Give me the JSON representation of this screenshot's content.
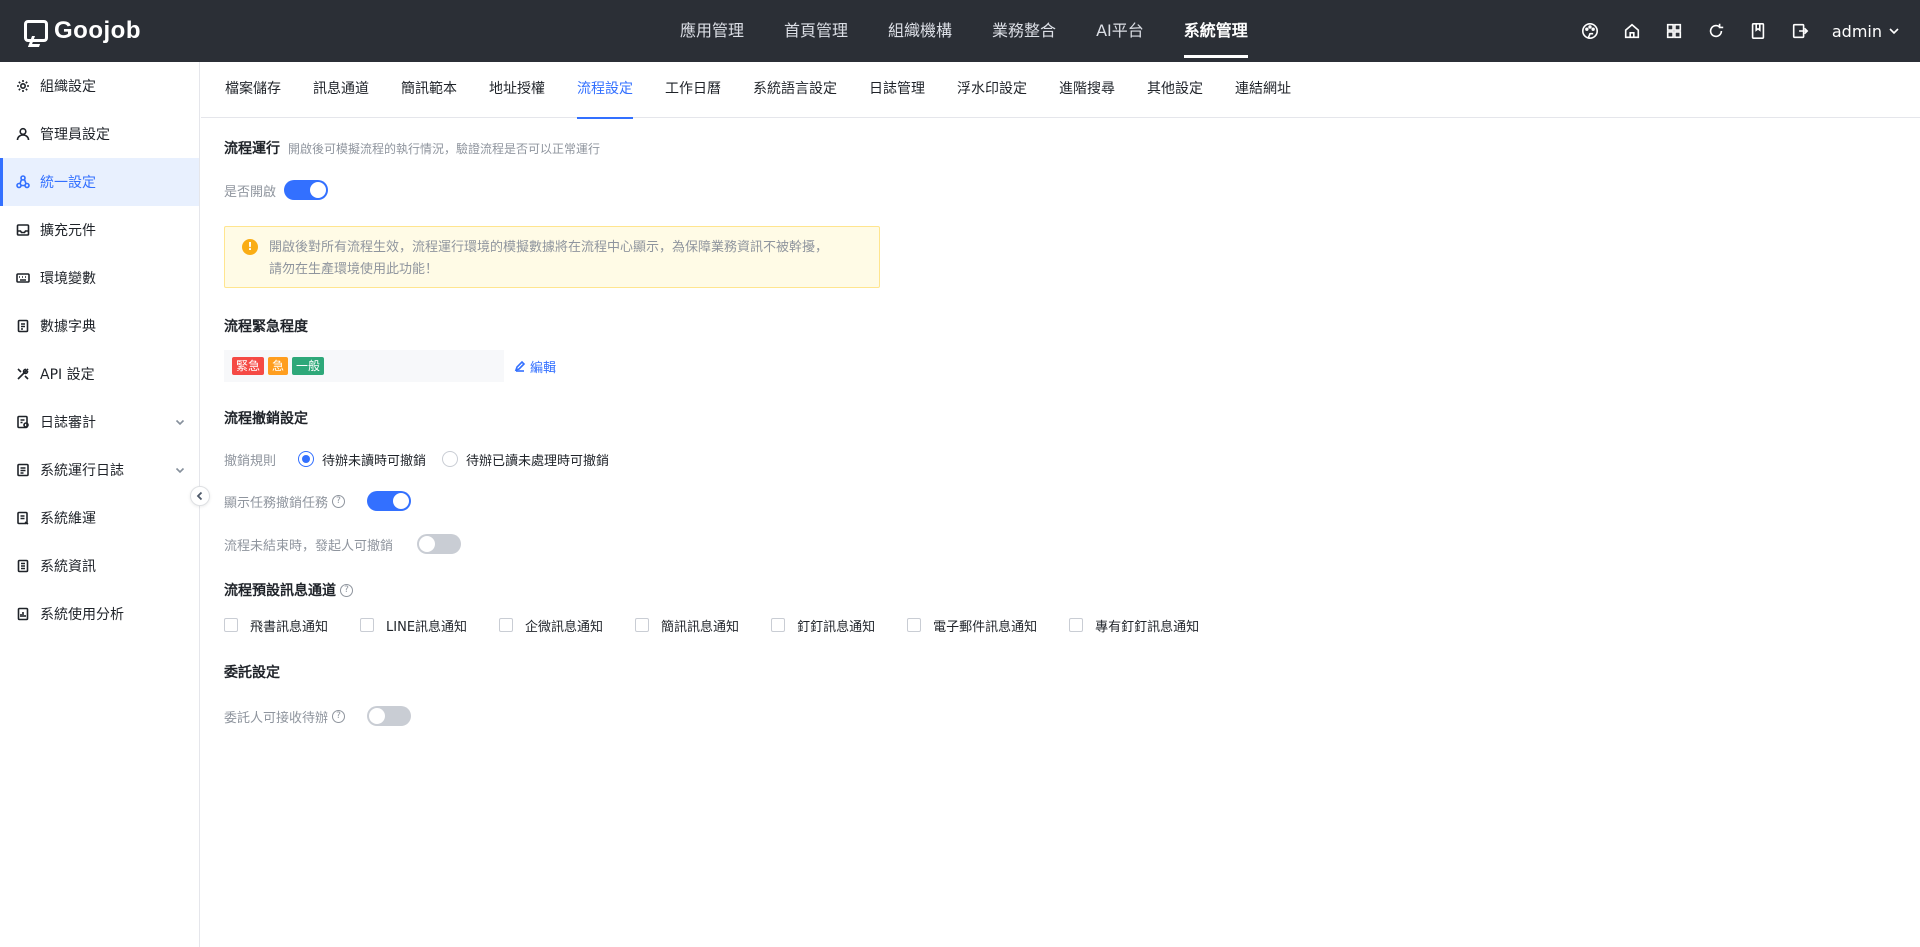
{
  "app": {
    "logo_text": "Goojob"
  },
  "topnav": [
    {
      "label": "應用管理"
    },
    {
      "label": "首頁管理"
    },
    {
      "label": "組織機構"
    },
    {
      "label": "業務整合"
    },
    {
      "label": "AI平台"
    },
    {
      "label": "系統管理",
      "active": true
    }
  ],
  "topright": {
    "icons": [
      "palette-icon",
      "home-icon",
      "grid-icon",
      "refresh-icon",
      "book-icon",
      "export-icon"
    ],
    "user": "admin"
  },
  "sidebar": {
    "items": [
      {
        "label": "組織設定",
        "icon": "gear-icon"
      },
      {
        "label": "管理員設定",
        "icon": "user-icon"
      },
      {
        "label": "統一設定",
        "icon": "cluster-icon",
        "active": true
      },
      {
        "label": "擴充元件",
        "icon": "inbox-icon"
      },
      {
        "label": "環境變數",
        "icon": "keyboard-icon"
      },
      {
        "label": "數據字典",
        "icon": "document-icon"
      },
      {
        "label": "API 設定",
        "icon": "tools-icon"
      },
      {
        "label": "日誌審計",
        "icon": "audit-icon",
        "expandable": true
      },
      {
        "label": "系統運行日誌",
        "icon": "log-icon",
        "expandable": true
      },
      {
        "label": "系統維運",
        "icon": "maintenance-icon"
      },
      {
        "label": "系統資訊",
        "icon": "info-doc-icon"
      },
      {
        "label": "系統使用分析",
        "icon": "analysis-icon"
      }
    ]
  },
  "subtabs": [
    {
      "label": "檔案儲存"
    },
    {
      "label": "訊息通道"
    },
    {
      "label": "簡訊範本"
    },
    {
      "label": "地址授權"
    },
    {
      "label": "流程設定",
      "active": true
    },
    {
      "label": "工作日曆"
    },
    {
      "label": "系統語言設定"
    },
    {
      "label": "日誌管理"
    },
    {
      "label": "浮水印設定"
    },
    {
      "label": "進階搜尋"
    },
    {
      "label": "其他設定"
    },
    {
      "label": "連結網址"
    }
  ],
  "flow_run": {
    "title": "流程運行",
    "desc": "開啟後可模擬流程的執行情況，驗證流程是否可以正常運行",
    "enable_label": "是否開啟",
    "enabled": true,
    "alert_line1": "開啟後對所有流程生效，流程運行環境的模擬數據將在流程中心顯示，為保障業務資訊不被幹擾，",
    "alert_line2": "請勿在生產環境使用此功能！",
    "alert_icon": "!"
  },
  "urgency": {
    "title": "流程緊急程度",
    "tags": [
      {
        "label": "緊急",
        "color": "#f54a45"
      },
      {
        "label": "急",
        "color": "#ff9e1f"
      },
      {
        "label": "一般",
        "color": "#2ea879"
      }
    ],
    "edit_label": "編輯"
  },
  "revoke": {
    "title": "流程撤銷設定",
    "rule_label": "撤銷規則",
    "options": [
      {
        "label": "待辦未讀時可撤銷",
        "checked": true
      },
      {
        "label": "待辦已讀未處理時可撤銷",
        "checked": false
      }
    ],
    "show_task_label": "顯示任務撤銷任務",
    "show_task_enabled": true,
    "initiator_label": "流程未結束時，發起人可撤銷",
    "initiator_enabled": false
  },
  "channels": {
    "title": "流程預設訊息通道",
    "options": [
      {
        "label": "飛書訊息通知"
      },
      {
        "label": "LINE訊息通知"
      },
      {
        "label": "企微訊息通知"
      },
      {
        "label": "簡訊訊息通知"
      },
      {
        "label": "釘釘訊息通知"
      },
      {
        "label": "電子郵件訊息通知"
      },
      {
        "label": "專有釘釘訊息通知"
      }
    ]
  },
  "delegate": {
    "title": "委託設定",
    "receive_label": "委託人可接收待辦",
    "receive_enabled": false
  },
  "help_glyph": "?"
}
